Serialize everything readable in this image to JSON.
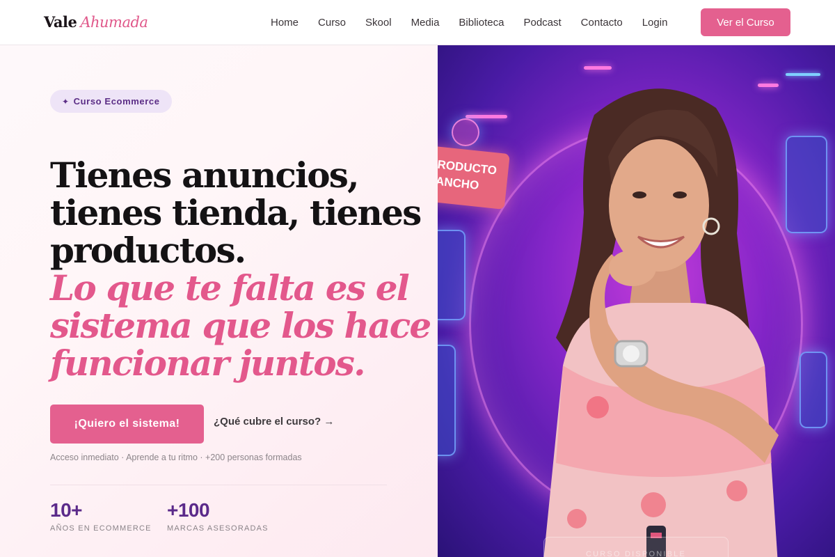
{
  "nav": {
    "logo_first": "Vale",
    "logo_last": "Ahumada",
    "links": [
      "Home",
      "Curso",
      "Skool",
      "Media",
      "Biblioteca",
      "Podcast",
      "Contacto",
      "Login"
    ],
    "cta_label": "Ver el Curso"
  },
  "hero": {
    "pill_icon": "✦",
    "pill_label": "Curso Ecommerce",
    "headline_lines": [
      "Tienes anuncios,",
      "tienes tienda, tienes",
      "productos."
    ],
    "accent_lines": [
      "Lo que te falta es el",
      "sistema que los hace",
      "funcionar juntos."
    ],
    "primary_button": "¡Quiero el sistema!",
    "secondary_link": "¿Qué cubre el curso? →",
    "note": "Acceso inmediato · Aprende a tu ritmo · +200 personas formadas",
    "stats": [
      {
        "value": "10+",
        "label": "AÑOS EN ECOMMERCE"
      },
      {
        "value": "+100",
        "label": "MARCAS ASESORADAS"
      }
    ]
  },
  "image": {
    "tag_text": "RODUCTO\nANCHO",
    "badge_text": "CURSO DISPONIBLE"
  },
  "colors": {
    "brand_pink": "#e4608f",
    "accent_purple": "#5b2a8a",
    "pill_bg": "#eee4f7"
  }
}
